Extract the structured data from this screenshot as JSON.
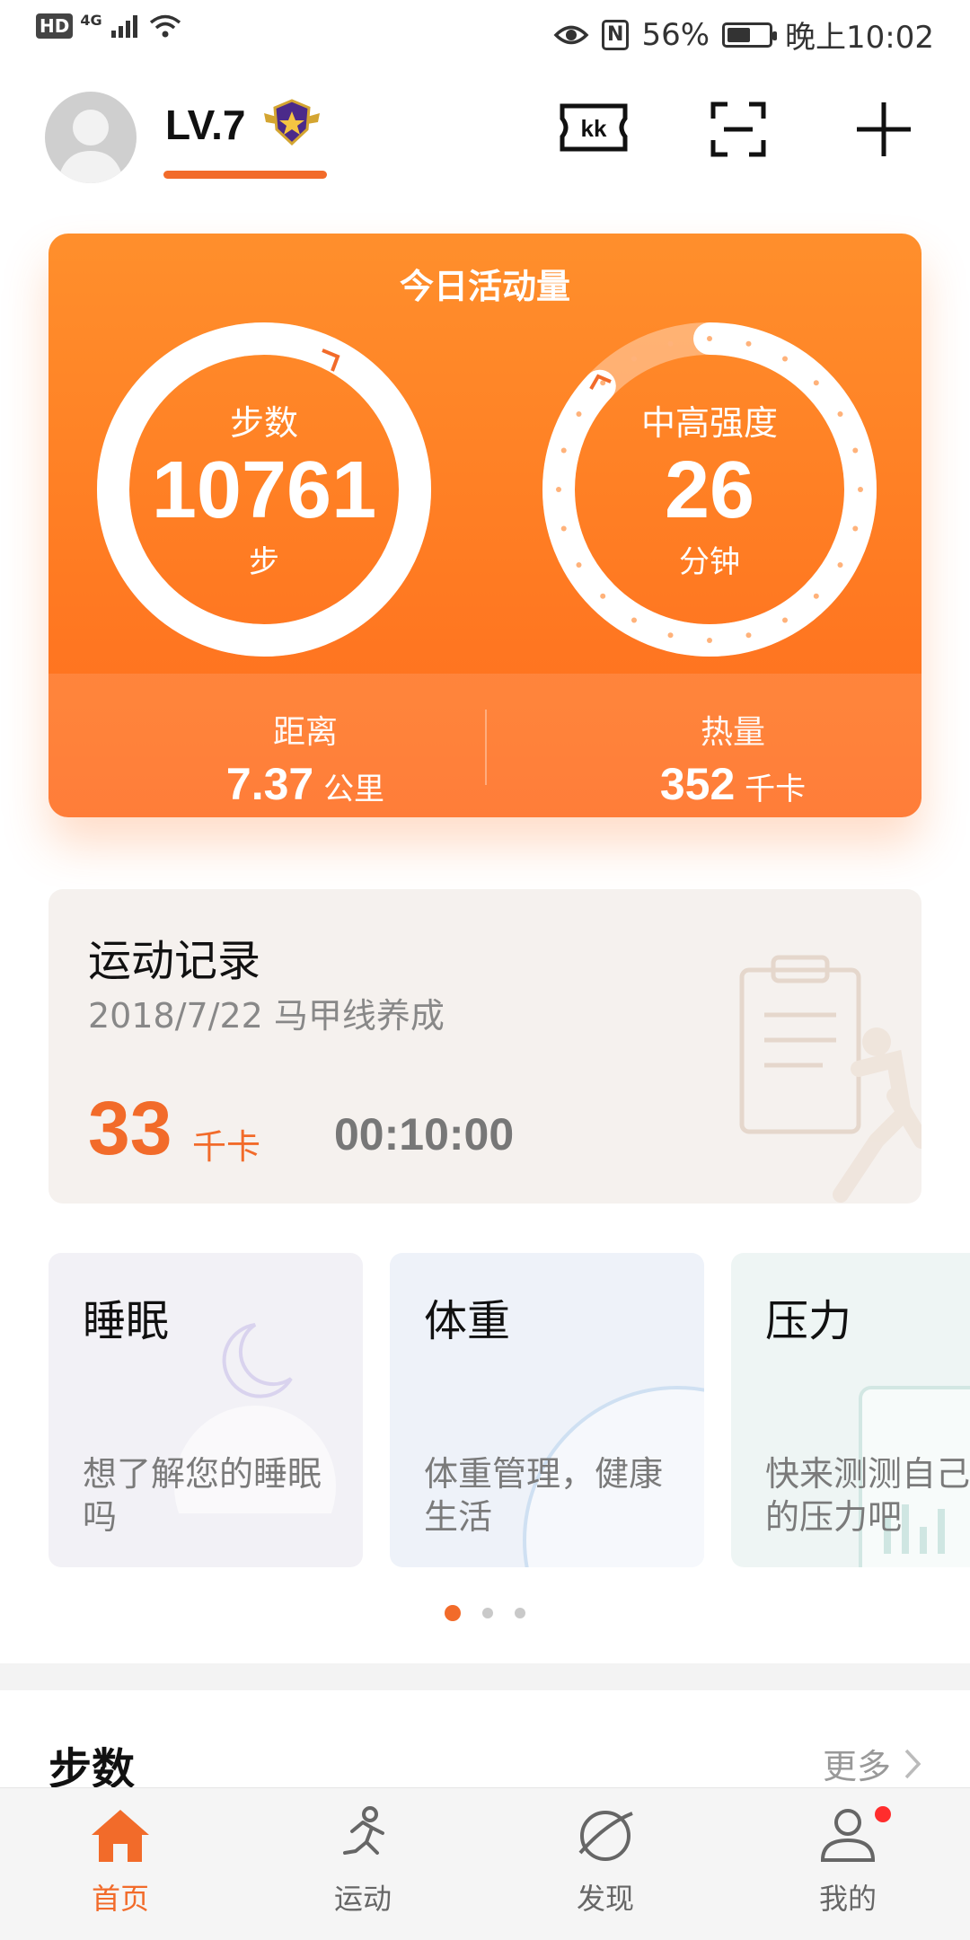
{
  "status_bar": {
    "left_badge": "HD",
    "network": "4G",
    "battery_percent": "56%",
    "battery_level": 0.56,
    "time": "晚上10:02"
  },
  "header": {
    "level": "LV.7",
    "level_progress": 1.0,
    "icons": [
      "kk-ticket-icon",
      "scan-icon",
      "add-icon"
    ],
    "kk_text": "kk"
  },
  "activity": {
    "title": "今日活动量",
    "steps": {
      "label": "步数",
      "value": "10761",
      "unit": "步",
      "progress": 1.0
    },
    "intensity": {
      "label": "中高强度",
      "value": "26",
      "unit": "分钟",
      "progress": 0.87
    },
    "distance": {
      "label": "距离",
      "value": "7.37",
      "unit": "公里"
    },
    "calories": {
      "label": "热量",
      "value": "352",
      "unit": "千卡"
    }
  },
  "record": {
    "title": "运动记录",
    "subtitle": "2018/7/22  马甲线养成",
    "kcal_value": "33",
    "kcal_unit": "千卡",
    "duration": "00:10:00"
  },
  "features": [
    {
      "title": "睡眠",
      "desc": "想了解您的睡眠吗"
    },
    {
      "title": "体重",
      "desc": "体重管理，健康生活"
    },
    {
      "title": "压力",
      "desc": "快来测测自己的压力吧"
    }
  ],
  "pager": {
    "count": 3,
    "active": 0
  },
  "steps_section": {
    "title": "步数",
    "more": "更多"
  },
  "nav": [
    {
      "label": "首页",
      "icon": "home-icon",
      "active": true
    },
    {
      "label": "运动",
      "icon": "running-icon",
      "active": false
    },
    {
      "label": "发现",
      "icon": "discover-icon",
      "active": false
    },
    {
      "label": "我的",
      "icon": "profile-icon",
      "active": false
    }
  ],
  "colors": {
    "accent": "#f26b2a",
    "card_gradient_top": "#ff8f2c",
    "card_gradient_bottom": "#ff6c1e"
  }
}
